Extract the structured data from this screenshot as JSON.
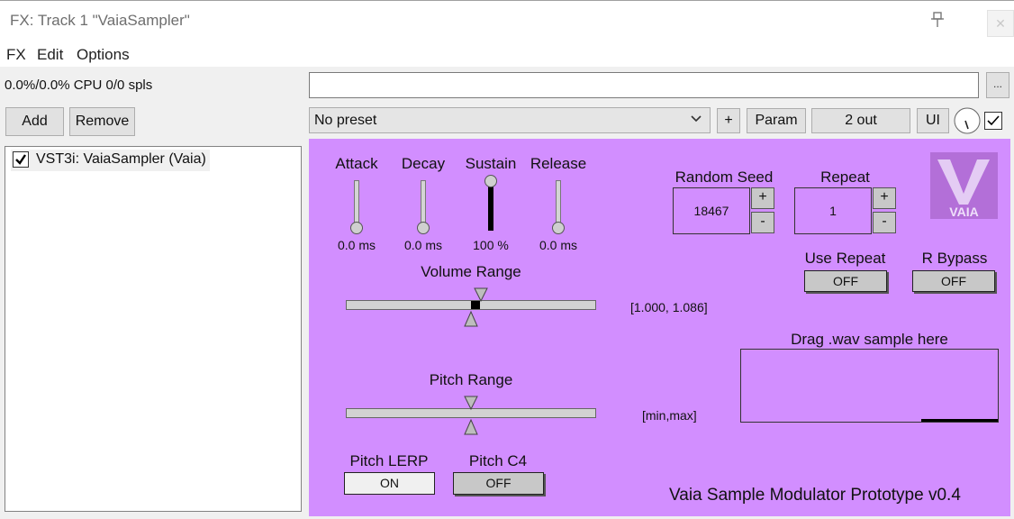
{
  "window": {
    "title": "FX: Track 1 \"VaiaSampler\"",
    "close_label": "✕"
  },
  "menu": {
    "items": [
      "FX",
      "Edit",
      "Options"
    ]
  },
  "left": {
    "cpu": "0.0%/0.0% CPU 0/0 spls",
    "add_label": "Add",
    "remove_label": "Remove",
    "fx_items": [
      {
        "label": "VST3i: VaiaSampler (Vaia)",
        "checked": true
      }
    ]
  },
  "toolbar": {
    "preset_name_value": "",
    "dots_label": "...",
    "preset": "No preset",
    "plus_label": "+",
    "param_label": "Param",
    "out_label": "2 out",
    "ui_label": "UI",
    "enabled": true
  },
  "plugin": {
    "bg_color": "#d28eff",
    "envelope": [
      {
        "label": "Attack",
        "value": "0.0 ms",
        "level": 0
      },
      {
        "label": "Decay",
        "value": "0.0 ms",
        "level": 0
      },
      {
        "label": "Sustain",
        "value": "100 %",
        "level": 1
      },
      {
        "label": "Release",
        "value": "0.0 ms",
        "level": 0
      }
    ],
    "volume_range": {
      "label": "Volume Range",
      "value": "[1.000, 1.086]"
    },
    "pitch_range": {
      "label": "Pitch Range",
      "value": "[min,max]"
    },
    "pitch_lerp": {
      "label": "Pitch LERP",
      "state": "ON"
    },
    "pitch_c4": {
      "label": "Pitch C4",
      "state": "OFF"
    },
    "random_seed": {
      "label": "Random Seed",
      "value": "18467",
      "plus": "+",
      "minus": "-"
    },
    "repeat": {
      "label": "Repeat",
      "value": "1",
      "plus": "+",
      "minus": "-"
    },
    "use_repeat": {
      "label": "Use Repeat",
      "state": "OFF"
    },
    "r_bypass": {
      "label": "R Bypass",
      "state": "OFF"
    },
    "drop_zone": {
      "label": "Drag .wav sample here"
    },
    "logo_text": "VAIA",
    "footer": "Vaia Sample Modulator Prototype v0.4"
  }
}
